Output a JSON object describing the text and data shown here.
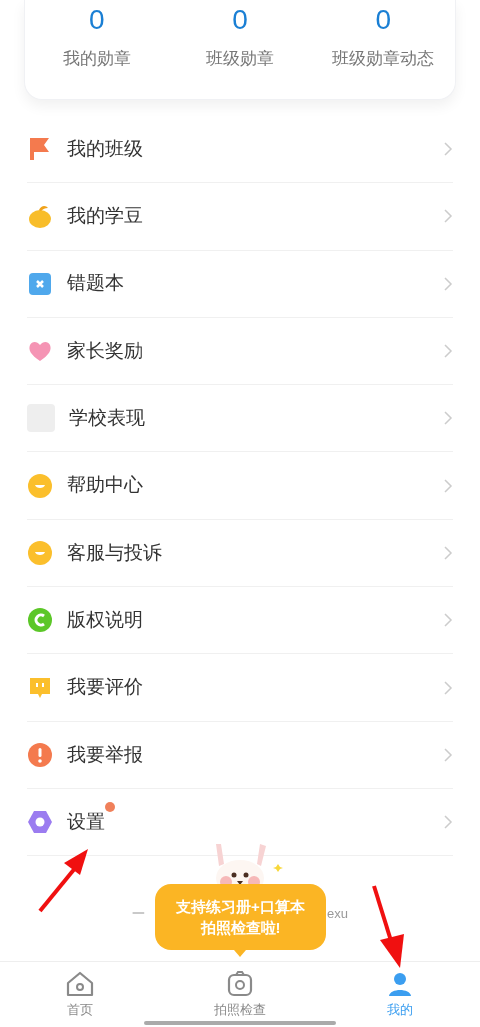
{
  "stats": [
    {
      "value": "0",
      "label": "我的勋章"
    },
    {
      "value": "0",
      "label": "班级勋章"
    },
    {
      "value": "0",
      "label": "班级勋章动态"
    }
  ],
  "menu": [
    {
      "kind": "flag",
      "label": "我的班级",
      "dot": false
    },
    {
      "kind": "bean",
      "label": "我的学豆",
      "dot": false
    },
    {
      "kind": "cross",
      "label": "错题本",
      "dot": false
    },
    {
      "kind": "heart",
      "label": "家长奖励",
      "dot": false
    },
    {
      "kind": "blank",
      "label": "学校表现",
      "dot": false
    },
    {
      "kind": "smile",
      "label": "帮助中心",
      "dot": false
    },
    {
      "kind": "smile",
      "label": "客服与投诉",
      "dot": false
    },
    {
      "kind": "copyright",
      "label": "版权说明",
      "dot": false
    },
    {
      "kind": "chat",
      "label": "我要评价",
      "dot": false
    },
    {
      "kind": "alert",
      "label": "我要举报",
      "dot": false
    },
    {
      "kind": "hexagon",
      "label": "设置",
      "dot": true
    }
  ],
  "footer": {
    "left": "一",
    "right": "exu"
  },
  "tooltip": {
    "line_1": "支持练习册+口算本",
    "line_2": "拍照检查啦!"
  },
  "tabs": [
    {
      "kind": "home",
      "label": "首页",
      "selected": false
    },
    {
      "kind": "camera",
      "label": "拍照检查",
      "selected": false
    },
    {
      "kind": "person",
      "label": "我的",
      "selected": true
    }
  ]
}
